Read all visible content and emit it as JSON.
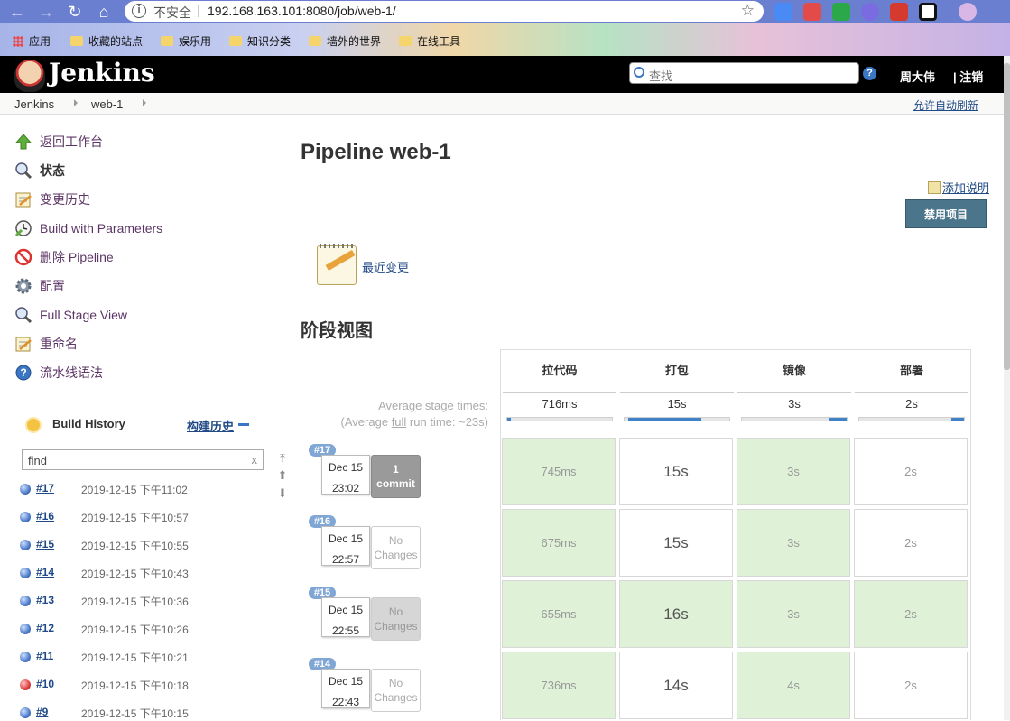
{
  "browser": {
    "insecure_label": "不安全",
    "url": "192.168.163.101:8080/job/web-1/",
    "bookmarks": [
      "应用",
      "收藏的站点",
      "娱乐用",
      "知识分类",
      "墙外的世界",
      "在线工具"
    ]
  },
  "header": {
    "title": "Jenkins",
    "search_placeholder": "查找",
    "help": "?",
    "user": "周大伟",
    "logout": "| 注销"
  },
  "breadcrumb": {
    "items": [
      "Jenkins",
      "web-1"
    ],
    "auto_refresh": "允许自动刷新"
  },
  "tasks": [
    {
      "label": "返回工作台",
      "icon": "up-arrow-icon"
    },
    {
      "label": "状态",
      "icon": "magnifier-icon"
    },
    {
      "label": "变更历史",
      "icon": "notepad-icon"
    },
    {
      "label": "Build with Parameters",
      "icon": "clock-icon"
    },
    {
      "label": "删除 Pipeline",
      "icon": "no-entry-icon"
    },
    {
      "label": "配置",
      "icon": "gear-icon"
    },
    {
      "label": "Full Stage View",
      "icon": "magnifier-icon"
    },
    {
      "label": "重命名",
      "icon": "notepad-icon"
    },
    {
      "label": "流水线语法",
      "icon": "help-icon"
    }
  ],
  "build_history": {
    "title": "Build History",
    "trend_link": "构建历史",
    "filter_value": "find",
    "clear": "x",
    "builds": [
      {
        "num": "#17",
        "date": "2019-12-15 下午11:02",
        "status": "blue"
      },
      {
        "num": "#16",
        "date": "2019-12-15 下午10:57",
        "status": "blue"
      },
      {
        "num": "#15",
        "date": "2019-12-15 下午10:55",
        "status": "blue"
      },
      {
        "num": "#14",
        "date": "2019-12-15 下午10:43",
        "status": "blue"
      },
      {
        "num": "#13",
        "date": "2019-12-15 下午10:36",
        "status": "blue"
      },
      {
        "num": "#12",
        "date": "2019-12-15 下午10:26",
        "status": "blue"
      },
      {
        "num": "#11",
        "date": "2019-12-15 下午10:21",
        "status": "blue"
      },
      {
        "num": "#10",
        "date": "2019-12-15 下午10:18",
        "status": "red"
      },
      {
        "num": "#9",
        "date": "2019-12-15 下午10:15",
        "status": "blue"
      }
    ]
  },
  "main": {
    "title": "Pipeline web-1",
    "add_description": "添加说明",
    "disable_button": "禁用项目",
    "recent_changes": "最近变更",
    "stage_view_title": "阶段视图",
    "avg_label_1": "Average stage times:",
    "avg_label_2a": "(Average ",
    "avg_label_full": "full",
    "avg_label_2b": " run time: ~23s)"
  },
  "stage_view": {
    "stages": [
      "拉代码",
      "打包",
      "镜像",
      "部署"
    ],
    "avg_times": [
      "716ms",
      "15s",
      "3s",
      "2s"
    ],
    "avg_fill": [
      0.03,
      0.7,
      0.17,
      0.12
    ],
    "runs": [
      {
        "badge": "#17",
        "date": "Dec 15",
        "time": "23:02",
        "changes_1": "1",
        "changes_2": "commit",
        "changes_style": "dark",
        "cells": [
          {
            "v": "745ms",
            "c": "green"
          },
          {
            "v": "15s",
            "c": "white"
          },
          {
            "v": "3s",
            "c": "green"
          },
          {
            "v": "2s",
            "c": "white"
          }
        ]
      },
      {
        "badge": "#16",
        "date": "Dec 15",
        "time": "22:57",
        "changes_1": "No",
        "changes_2": "Changes",
        "changes_style": "light",
        "cells": [
          {
            "v": "675ms",
            "c": "green"
          },
          {
            "v": "15s",
            "c": "white"
          },
          {
            "v": "3s",
            "c": "green"
          },
          {
            "v": "2s",
            "c": "white"
          }
        ]
      },
      {
        "badge": "#15",
        "date": "Dec 15",
        "time": "22:55",
        "changes_1": "No",
        "changes_2": "Changes",
        "changes_style": "grey",
        "cells": [
          {
            "v": "655ms",
            "c": "green"
          },
          {
            "v": "16s",
            "c": "green"
          },
          {
            "v": "3s",
            "c": "green"
          },
          {
            "v": "2s",
            "c": "green"
          }
        ]
      },
      {
        "badge": "#14",
        "date": "Dec 15",
        "time": "22:43",
        "changes_1": "No",
        "changes_2": "Changes",
        "changes_style": "light",
        "cells": [
          {
            "v": "736ms",
            "c": "green"
          },
          {
            "v": "14s",
            "c": "white"
          },
          {
            "v": "4s",
            "c": "green"
          },
          {
            "v": "2s",
            "c": "white"
          }
        ]
      }
    ]
  }
}
